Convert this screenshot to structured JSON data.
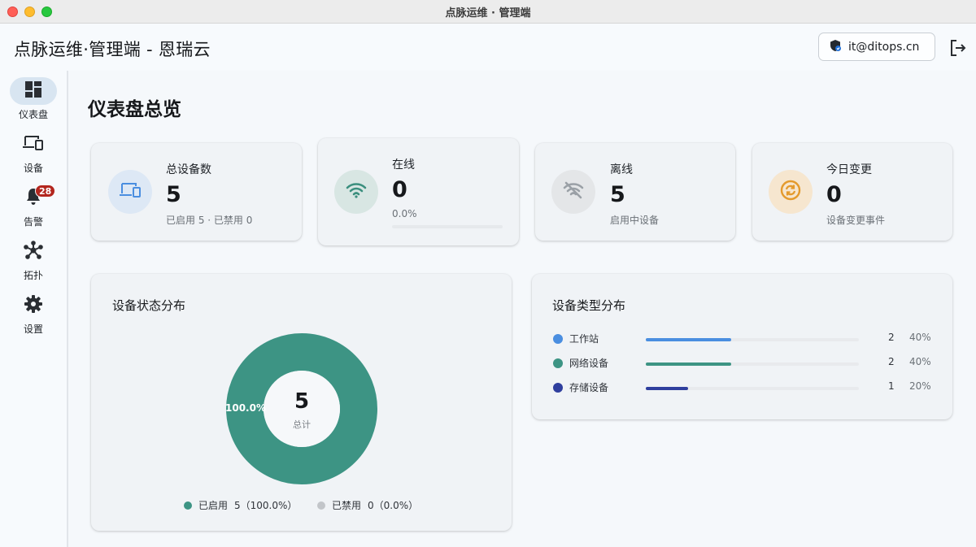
{
  "window": {
    "title": "点脉运维 · 管理端"
  },
  "header": {
    "app_title": "点脉运维·管理端 - 恩瑞云",
    "account_email": "it@ditops.cn",
    "account_icon": "shield-icon",
    "logout_icon": "logout-icon"
  },
  "sidebar": {
    "items": [
      {
        "label": "仪表盘",
        "icon": "dashboard-icon",
        "active": true
      },
      {
        "label": "设备",
        "icon": "devices-icon"
      },
      {
        "label": "告警",
        "icon": "bell-icon",
        "badge": "28"
      },
      {
        "label": "拓扑",
        "icon": "topology-icon"
      },
      {
        "label": "设置",
        "icon": "gear-icon"
      }
    ]
  },
  "main": {
    "page_title": "仪表盘总览",
    "stats": [
      {
        "label": "总设备数",
        "value": "5",
        "sub": "已启用 5 · 已禁用 0",
        "icon": "devices-icon",
        "color": "#4a8ee0"
      },
      {
        "label": "在线",
        "value": "0",
        "sub": "0.0%",
        "progress": 0.0,
        "icon": "wifi-icon",
        "color": "#3b8f7e"
      },
      {
        "label": "离线",
        "value": "5",
        "sub": "启用中设备",
        "icon": "wifi-off-icon",
        "color": "#9aa0a6"
      },
      {
        "label": "今日变更",
        "value": "0",
        "sub": "设备变更事件",
        "icon": "sync-icon",
        "color": "#e49a2c"
      }
    ],
    "status_panel": {
      "title": "设备状态分布",
      "total": "5",
      "total_label": "总计",
      "slice_label": "100.0%",
      "legend": [
        {
          "label": "已启用",
          "value": "5（100.0%）",
          "color": "#3d9484"
        },
        {
          "label": "已禁用",
          "value": "0（0.0%）",
          "color": "#c2c5c9"
        }
      ]
    },
    "type_panel": {
      "title": "设备类型分布",
      "rows": [
        {
          "name": "工作站",
          "count": "2",
          "pct": "40%",
          "fraction": 0.4,
          "color": "#4a8ee0"
        },
        {
          "name": "网络设备",
          "count": "2",
          "pct": "40%",
          "fraction": 0.4,
          "color": "#3d9484"
        },
        {
          "name": "存储设备",
          "count": "1",
          "pct": "20%",
          "fraction": 0.2,
          "color": "#2f3f9e"
        }
      ]
    }
  }
}
